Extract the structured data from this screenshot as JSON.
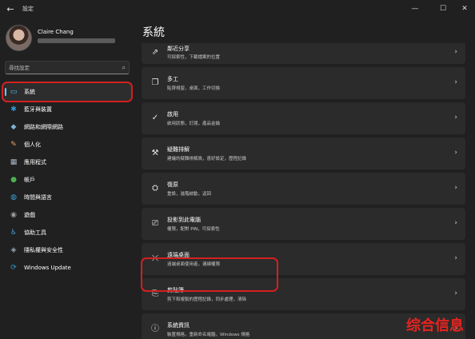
{
  "window": {
    "title": "設定",
    "back_glyph": "←",
    "min_glyph": "—",
    "max_glyph": "☐",
    "close_glyph": "✕"
  },
  "user": {
    "name": "Claire Chang"
  },
  "search": {
    "placeholder": "尋找設定",
    "icon": "search-icon"
  },
  "page_title": "系統",
  "sidebar": {
    "items": [
      {
        "label": "系統",
        "icon": "display-icon",
        "glyph": "▭",
        "color": "#4fc3f7",
        "selected": true
      },
      {
        "label": "藍牙與裝置",
        "icon": "bluetooth-icon",
        "glyph": "✱",
        "color": "#2d9cdb"
      },
      {
        "label": "網路和網際網路",
        "icon": "network-icon",
        "glyph": "◆",
        "color": "#7fb3d5"
      },
      {
        "label": "個人化",
        "icon": "brush-icon",
        "glyph": "✎",
        "color": "#e8a36b"
      },
      {
        "label": "應用程式",
        "icon": "apps-icon",
        "glyph": "▦",
        "color": "#a9b7c6"
      },
      {
        "label": "帳戶",
        "icon": "account-icon",
        "glyph": "●",
        "color": "#4caf50"
      },
      {
        "label": "時間與語言",
        "icon": "globe-icon",
        "glyph": "◍",
        "color": "#38a3d8"
      },
      {
        "label": "遊戲",
        "icon": "gamepad-icon",
        "glyph": "◉",
        "color": "#9e9e9e"
      },
      {
        "label": "協助工具",
        "icon": "accessibility-icon",
        "glyph": "♿",
        "color": "#3fa0e0"
      },
      {
        "label": "隱私權與安全性",
        "icon": "shield-icon",
        "glyph": "◈",
        "color": "#9aa5b1"
      },
      {
        "label": "Windows Update",
        "icon": "update-icon",
        "glyph": "⟳",
        "color": "#2d9cdb"
      }
    ]
  },
  "cards": [
    {
      "title": "鄰近分享",
      "desc": "可探索性，下載檔案的位置",
      "icon": "share-icon",
      "glyph": "⇗",
      "partial": true
    },
    {
      "title": "多工",
      "desc": "貼齊視窗，桌面，工作切換",
      "icon": "multitask-icon",
      "glyph": "❐"
    },
    {
      "title": "啟用",
      "desc": "啟用狀態，訂閱，產品金鑰",
      "icon": "check-circle-icon",
      "glyph": "✓"
    },
    {
      "title": "疑難排解",
      "desc": "建議的疑難排解員，喜好設定，歷程記錄",
      "icon": "wrench-icon",
      "glyph": "⚒"
    },
    {
      "title": "復原",
      "desc": "重設，進階啟動，返回",
      "icon": "recovery-icon",
      "glyph": "⛭"
    },
    {
      "title": "投影到此電腦",
      "desc": "權限，配對 PIN，可探索性",
      "icon": "project-icon",
      "glyph": "⎚"
    },
    {
      "title": "遠端桌面",
      "desc": "遠端桌面使用者，連線權限",
      "icon": "remote-desktop-icon",
      "glyph": "⤫"
    },
    {
      "title": "剪貼簿",
      "desc": "剪下和複製的歷程記錄，同步處理，清除",
      "icon": "clipboard-icon",
      "glyph": "⎘"
    },
    {
      "title": "系統資訊",
      "desc": "裝置規格，重新命名電腦，Windows 規格",
      "icon": "info-icon",
      "glyph": "ⓘ"
    }
  ],
  "chevron_glyph": "›",
  "watermark": "综合信息",
  "colors": {
    "accent": "#60cdff",
    "highlight_red": "#d42020",
    "background": "#202020",
    "card": "#2b2b2b"
  }
}
